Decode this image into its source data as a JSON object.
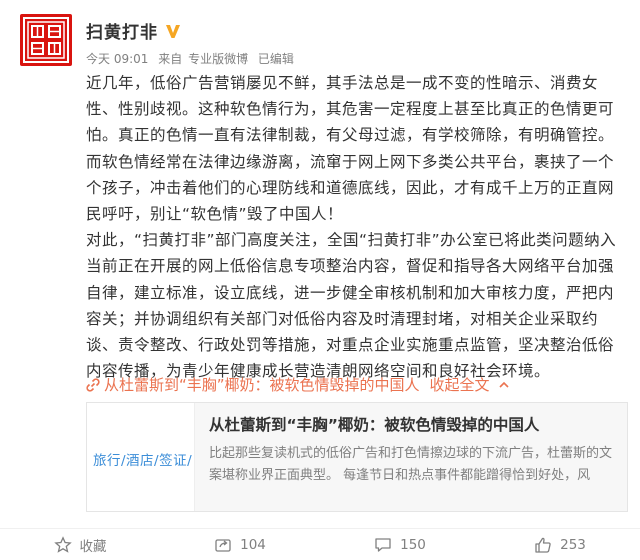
{
  "header": {
    "author": "扫黄打非",
    "verified_icon": "verified-v-icon",
    "meta": {
      "time": "今天 09:01",
      "source_prefix": "来自",
      "source": "专业版微博",
      "edited": "已编辑"
    }
  },
  "content": {
    "paragraph1": "近几年，低俗广告营销屡见不鲜，其手法总是一成不变的性暗示、消费女性、性别歧视。这种软色情行为，其危害一定程度上甚至比真正的色情更可怕。真正的色情一直有法律制裁，有父母过滤，有学校筛除，有明确管控。而软色情经常在法律边缘游离，流窜于网上网下多类公共平台，裹挟了一个个孩子，冲击着他们的心理防线和道德底线，因此，才有成千上万的正直网民呼吁，别让“软色情”毁了中国人！",
    "paragraph2": "对此，“扫黄打非”部门高度关注，全国“扫黄打非”办公室已将此类问题纳入当前正在开展的网上低俗信息专项整治内容，督促和指导各大网络平台加强自律，建立标准，设立底线，进一步健全审核机制和加大审核力度，严把内容关；并协调组织有关部门对低俗内容及时清理封堵，对相关企业采取约谈、责令整改、行政处罚等措施，对重点企业实施重点监管，坚决整治低俗内容传播，为青少年健康成长营造清朗网络空间和良好社会环境。"
  },
  "link": {
    "text": "从杜蕾斯到“丰胸”椰奶：被软色情毁掉的中国人",
    "collapse": "收起全文"
  },
  "card": {
    "thumb_text": "旅行/酒店/签证/",
    "title": "从杜蕾斯到“丰胸”椰奶：被软色情毁掉的中国人",
    "desc": "比起那些复读机式的低俗广告和打色情擦边球的下流广告，杜蕾斯的文案堪称业界正面典型。 每逢节日和热点事件都能蹭得恰到好处，风"
  },
  "footer": {
    "favorite": "收藏",
    "forward": "104",
    "comment": "150",
    "like": "253"
  },
  "colors": {
    "avatar_red": "#d9140f",
    "link_orange": "#eb7350",
    "verified_gold": "#f5a623",
    "thumb_blue": "#3c8ed8",
    "meta_gray": "#808080"
  }
}
